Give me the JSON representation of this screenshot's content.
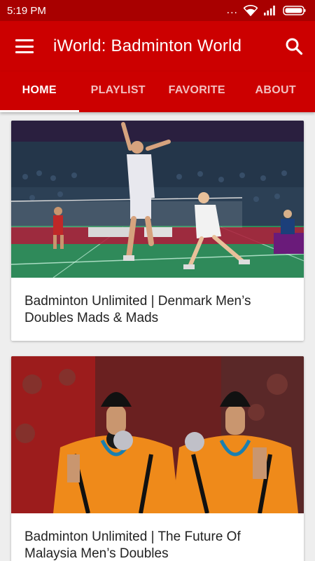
{
  "status_bar": {
    "time": "5:19 PM",
    "dots": "..."
  },
  "app_bar": {
    "title": "iWorld: Badminton World"
  },
  "tabs": [
    {
      "label": "HOME",
      "active": true
    },
    {
      "label": "PLAYLIST",
      "active": false
    },
    {
      "label": "FAVORITE",
      "active": false
    },
    {
      "label": "ABOUT",
      "active": false
    }
  ],
  "videos": [
    {
      "title": "Badminton Unlimited | Denmark Men’s Doubles Mads & Mads",
      "thumbnail": "badminton-match-doubles-smash"
    },
    {
      "title": "Badminton Unlimited | The Future Of Malaysia Men’s Doubles",
      "thumbnail": "malaysia-players-silver-medals"
    }
  ],
  "colors": {
    "primary": "#cc0000",
    "status_bar": "#a80000",
    "background": "#eeeeee"
  }
}
